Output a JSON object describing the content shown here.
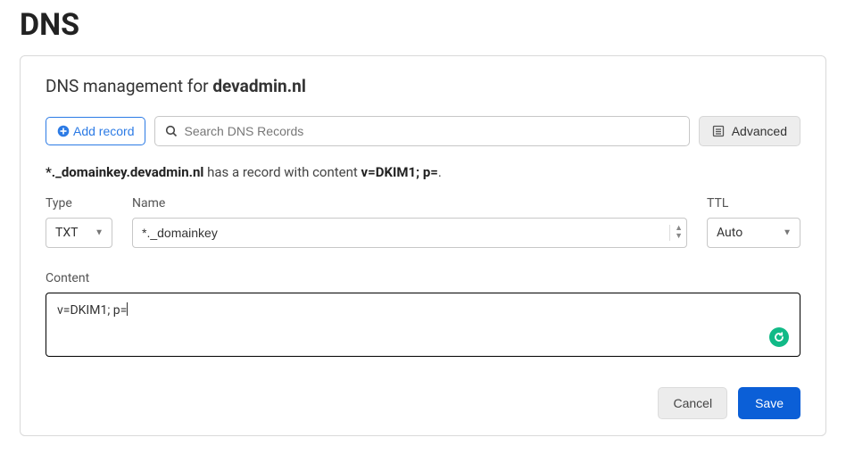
{
  "page": {
    "title": "DNS"
  },
  "panel": {
    "heading_prefix": "DNS management for ",
    "domain": "devadmin.nl"
  },
  "toolbar": {
    "add_label": "Add record",
    "search_placeholder": "Search DNS Records",
    "advanced_label": "Advanced"
  },
  "record_desc": {
    "host_bold": "*._domainkey.devadmin.nl",
    "mid_text": " has a record with content ",
    "content_bold": "v=DKIM1; p=",
    "trailing": "."
  },
  "form": {
    "type": {
      "label": "Type",
      "value": "TXT"
    },
    "name": {
      "label": "Name",
      "value": "*._domainkey"
    },
    "ttl": {
      "label": "TTL",
      "value": "Auto"
    },
    "content": {
      "label": "Content",
      "value": "v=DKIM1; p="
    }
  },
  "actions": {
    "cancel": "Cancel",
    "save": "Save"
  }
}
